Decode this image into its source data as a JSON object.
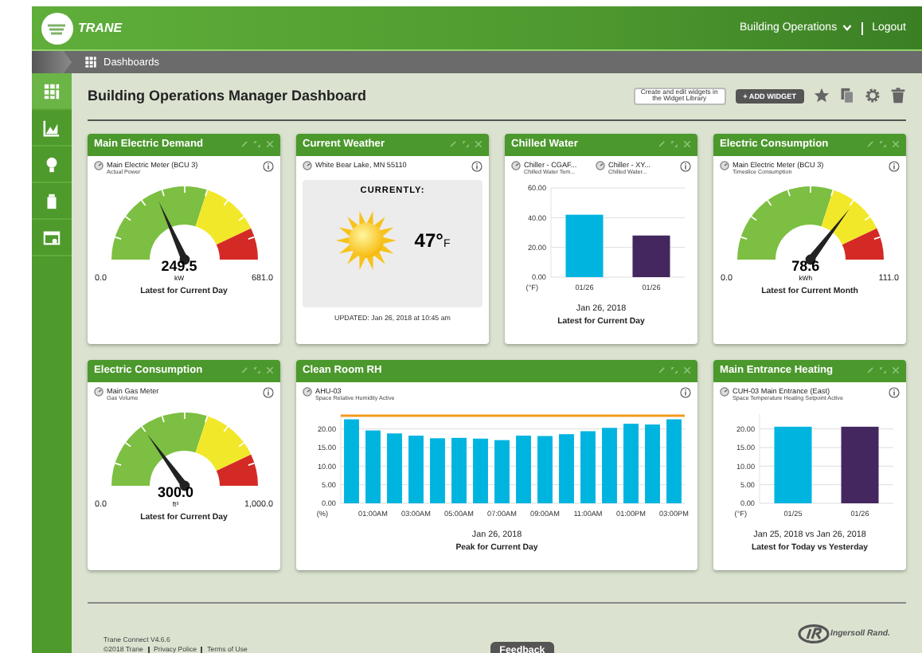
{
  "header": {
    "brand": "TRANE",
    "menu": "Building Operations",
    "logout": "Logout"
  },
  "breadcrumb": "Dashboards",
  "sidebar": [
    {
      "kind": "grid",
      "selected": true
    },
    {
      "kind": "chart",
      "selected": false
    },
    {
      "kind": "bulb",
      "selected": false
    },
    {
      "kind": "building",
      "selected": false
    },
    {
      "kind": "panel",
      "selected": false
    }
  ],
  "dashboard": {
    "title": "Building Operations Manager Dashboard",
    "hint": "Create and edit widgets in the Widget Library",
    "add_button": "+ ADD WIDGET"
  },
  "widgets": [
    {
      "kind": "gauge",
      "title": "Main Electric Demand",
      "sources": [
        {
          "name": "Main Electric Meter (BCU 3)",
          "detail": "Actual Power"
        }
      ],
      "value": "249.5",
      "unit": "kW",
      "min": "0.0",
      "max": "681.0",
      "footer": "Latest for Current Day"
    },
    {
      "kind": "weather",
      "title": "Current Weather",
      "sources": [
        {
          "name": "White Bear Lake, MN 55110"
        }
      ],
      "label": "CURRENTLY:",
      "temperature": "47°",
      "unit": "F",
      "updated": "UPDATED: Jan 26, 2018 at 10:45 am"
    },
    {
      "kind": "bar",
      "title": "Chilled Water",
      "sources": [
        {
          "name": "Chiller - CGAF...",
          "detail": "Chilled Water Tem..."
        },
        {
          "name": "Chiller - XY...",
          "detail": "Chilled Water..."
        }
      ],
      "date": "Jan 26, 2018",
      "footer": "Latest for Current Day",
      "chart_data": {
        "type": "bar",
        "ylabel": "(°F)",
        "grid": true,
        "categories": [
          "01/26",
          "01/26"
        ],
        "ylim": [
          0,
          60
        ],
        "yticks": [
          {
            "value": 0,
            "label": "0.00"
          },
          {
            "value": 20,
            "label": "20.00"
          },
          {
            "value": 40,
            "label": "40.00"
          },
          {
            "value": 60,
            "label": "60.00"
          }
        ],
        "series": [
          {
            "color": "#00b4e0",
            "values": [
              42,
              null
            ]
          },
          {
            "color": "#44275f",
            "values": [
              null,
              28
            ]
          }
        ]
      }
    },
    {
      "kind": "gauge",
      "title": "Electric Consumption",
      "sources": [
        {
          "name": "Main Electric Meter (BCU 3)",
          "detail": "Timeslice Consumption"
        }
      ],
      "value": "78.6",
      "unit": "kWh",
      "min": "0.0",
      "max": "111.0",
      "footer": "Latest for Current Month"
    },
    {
      "kind": "gauge",
      "title": "Electric Consumption",
      "sources": [
        {
          "name": "Main Gas Meter",
          "detail": "Gas Volume"
        }
      ],
      "value": "300.0",
      "unit": "ft³",
      "min": "0.0",
      "max": "1,000.0",
      "footer": "Latest for Current Day"
    },
    {
      "kind": "bar",
      "title": "Clean Room RH",
      "sources": [
        {
          "name": "AHU-03",
          "detail": "Space Relative Humidity Active"
        }
      ],
      "date": "Jan 26, 2018",
      "footer": "Peak for Current Day",
      "chart_data": {
        "type": "bar",
        "ylabel": "(%)",
        "grid": true,
        "x": [
          0,
          1,
          2,
          3,
          4,
          5,
          6,
          7,
          8,
          9,
          10,
          11,
          12,
          13,
          14,
          15
        ],
        "xlim": [
          -0.5,
          15.5
        ],
        "xticks": [
          {
            "value": 1,
            "label": "01:00AM"
          },
          {
            "value": 3,
            "label": "03:00AM"
          },
          {
            "value": 5,
            "label": "05:00AM"
          },
          {
            "value": 7,
            "label": "07:00AM"
          },
          {
            "value": 9,
            "label": "09:00AM"
          },
          {
            "value": 11,
            "label": "11:00AM"
          },
          {
            "value": 13,
            "label": "01:00PM"
          },
          {
            "value": 15,
            "label": "03:00PM"
          }
        ],
        "yticks": [
          {
            "value": 0,
            "label": "0.00"
          },
          {
            "value": 5,
            "label": "5.00"
          },
          {
            "value": 10,
            "label": "10.00"
          },
          {
            "value": 15,
            "label": "15.00"
          },
          {
            "value": 20,
            "label": "20.00"
          }
        ],
        "series": [
          {
            "color": "#00b4e0",
            "values": [
              22.6,
              19.6,
              18.8,
              18.2,
              17.5,
              17.6,
              17.4,
              17.0,
              18.2,
              18.1,
              18.6,
              19.4,
              20.3,
              21.4,
              21.2,
              22.6
            ]
          }
        ],
        "ylim": [
          0,
          24
        ]
      }
    },
    {
      "kind": "bar",
      "title": "Main Entrance Heating",
      "sources": [
        {
          "name": "CUH-03 Main Entrance (East)",
          "detail": "Space Temperature Heating Setpoint Active"
        }
      ],
      "date": "Jan 25, 2018 vs Jan 26, 2018",
      "footer": "Latest for Today vs Yesterday",
      "chart_data": {
        "type": "bar",
        "ylabel": "(°F)",
        "grid": true,
        "categories": [
          "01/25",
          "01/26"
        ],
        "ylim": [
          0,
          24
        ],
        "yticks": [
          {
            "value": 0,
            "label": "0.00"
          },
          {
            "value": 5,
            "label": "5.00"
          },
          {
            "value": 10,
            "label": "10.00"
          },
          {
            "value": 15,
            "label": "15.00"
          },
          {
            "value": 20,
            "label": "20.00"
          }
        ],
        "series": [
          {
            "color": "#00b4e0",
            "values": [
              20.6,
              null
            ]
          },
          {
            "color": "#44275f",
            "values": [
              null,
              20.6
            ]
          }
        ]
      }
    }
  ],
  "footer": {
    "version": "Trane Connect V4.6.6",
    "copyright": "©2018 Trane",
    "links": [
      "Privacy Police",
      "Terms of Use"
    ],
    "feedback": "Feedback",
    "partner": "Ingersoll Rand."
  }
}
